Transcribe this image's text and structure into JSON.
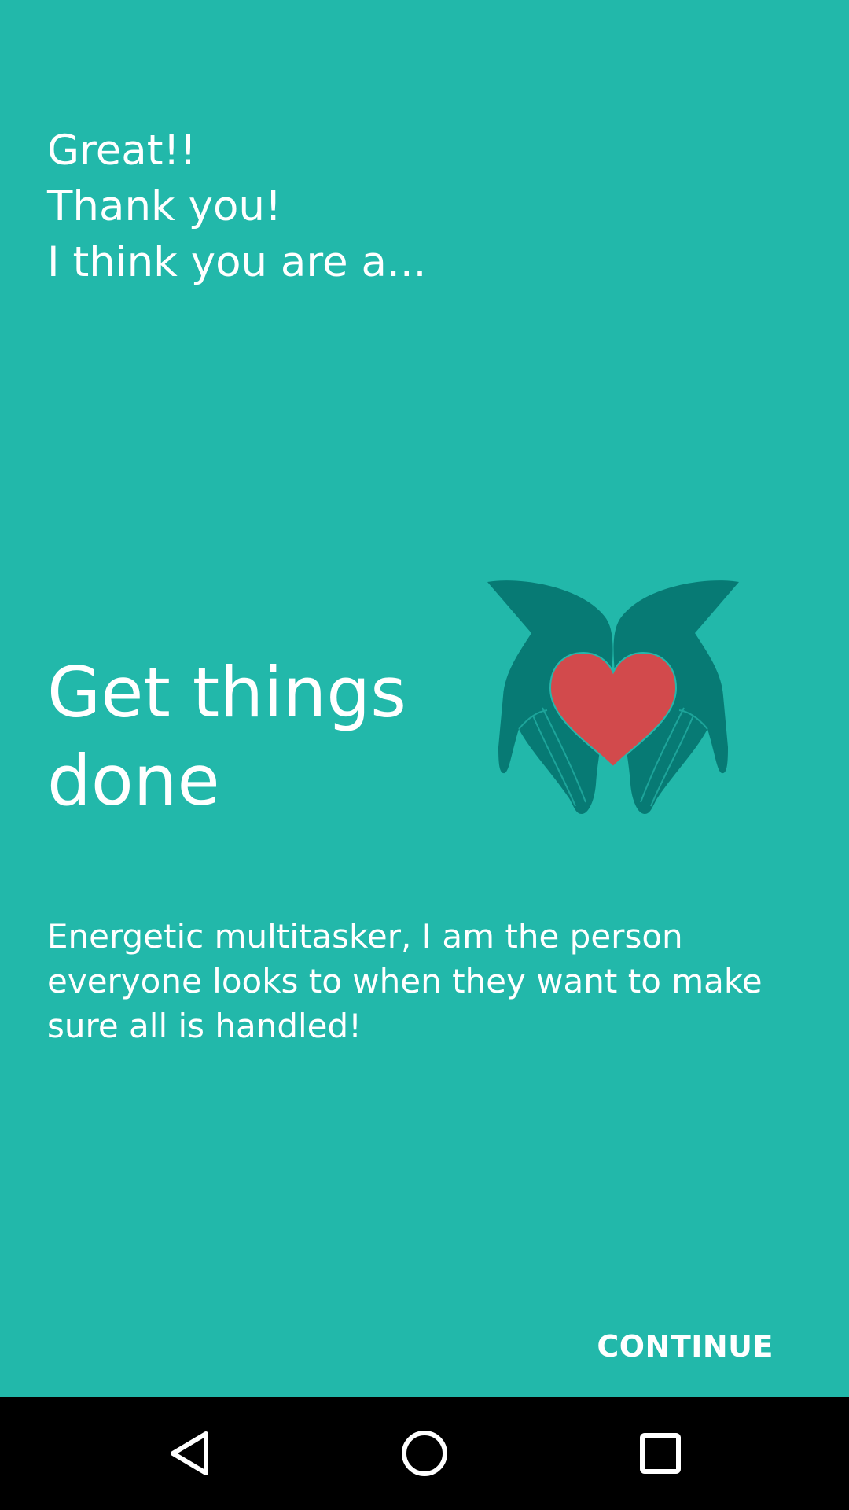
{
  "intro": {
    "lines": [
      "Great!!",
      "Thank you!",
      "I think you are a..."
    ]
  },
  "result": {
    "title_line1": "Get things",
    "title_line2": "done",
    "description": "Energetic multitasker, I am the person everyone looks to when they want to make sure all is handled!",
    "illustration": "hands-holding-heart-icon"
  },
  "actions": {
    "continue_label": "CONTINUE"
  },
  "navbar": {
    "back_icon": "back-triangle-icon",
    "home_icon": "home-circle-icon",
    "recents_icon": "recents-square-icon"
  },
  "colors": {
    "background": "#22b8aa",
    "hands": "#077a74",
    "heart": "#d24a4c",
    "text": "#ffffff",
    "navbar": "#000000"
  }
}
